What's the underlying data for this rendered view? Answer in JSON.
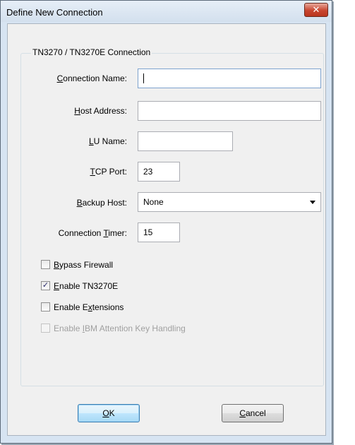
{
  "window": {
    "title": "Define New Connection",
    "close_glyph": "✕"
  },
  "group": {
    "label": "TN3270 / TN3270E Connection"
  },
  "fields": {
    "connection_name": {
      "label_pre": "",
      "label_u": "C",
      "label_post": "onnection Name:",
      "value": ""
    },
    "host_address": {
      "label_pre": "",
      "label_u": "H",
      "label_post": "ost Address:",
      "value": ""
    },
    "lu_name": {
      "label_pre": "",
      "label_u": "L",
      "label_post": "U Name:",
      "value": ""
    },
    "tcp_port": {
      "label_pre": "",
      "label_u": "T",
      "label_post": "CP Port:",
      "value": "23"
    },
    "backup_host": {
      "label_pre": "",
      "label_u": "B",
      "label_post": "ackup Host:",
      "value": "None"
    },
    "connection_timer": {
      "label_pre": "Connection ",
      "label_u": "T",
      "label_post": "imer:",
      "value": "15"
    }
  },
  "checkboxes": {
    "bypass_firewall": {
      "label_pre": "",
      "label_u": "B",
      "label_post": "ypass Firewall",
      "checked": false,
      "check_glyph": ""
    },
    "enable_tn3270e": {
      "label_pre": "",
      "label_u": "E",
      "label_post": "nable TN3270E",
      "checked": true,
      "check_glyph": "✓"
    },
    "enable_extensions": {
      "label_pre": "Enable E",
      "label_u": "x",
      "label_post": "tensions",
      "checked": false,
      "check_glyph": ""
    },
    "enable_ibm_attention": {
      "label_pre": "Enable ",
      "label_u": "I",
      "label_post": "BM Attention Key Handling",
      "checked": false,
      "check_glyph": ""
    }
  },
  "buttons": {
    "ok": {
      "label_pre": "",
      "label_u": "O",
      "label_post": "K"
    },
    "cancel": {
      "label_pre": "",
      "label_u": "C",
      "label_post": "ancel"
    }
  }
}
